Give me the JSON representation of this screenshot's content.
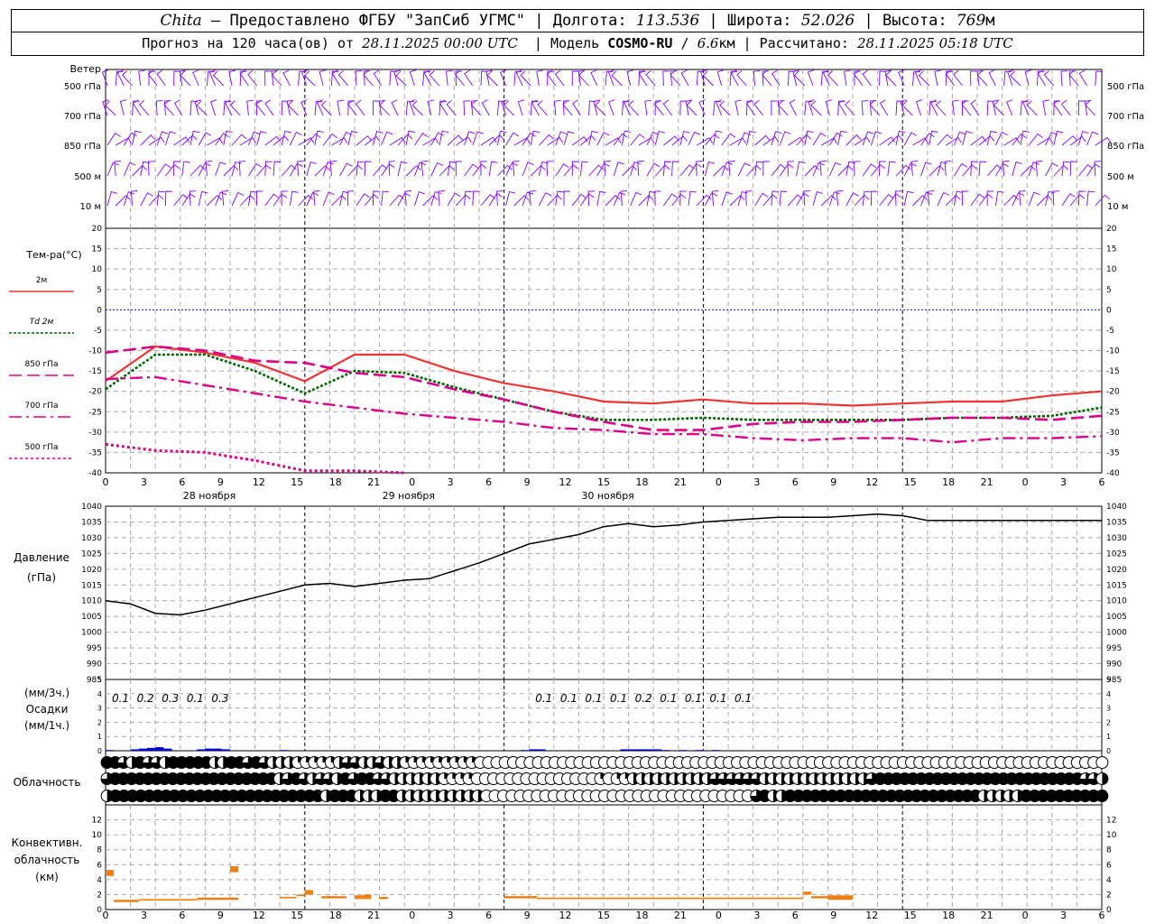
{
  "header": {
    "station": "Chita",
    "provider": " — Предоставлено ФГБУ \"ЗапСиб УГМС\" | Долгота: ",
    "lon": "113.536",
    "lat_label": " | Широта: ",
    "lat": "52.026",
    "alt_label": " | Высота: ",
    "alt": "769",
    "alt_unit": "м",
    "forecast_label": "Прогноз на 120 часа(ов) от ",
    "forecast_start": "28.11.2025 00:00 UTC",
    "model_label": "  | Модель ",
    "model": "COSMO-RU",
    "model_sep": " / ",
    "resolution": "6.6",
    "res_unit": "км",
    "calc_label": " | Рассчитано: ",
    "calc_time": "28.11.2025 05:18 UTC"
  },
  "labels": {
    "wind": "Ветер",
    "wind_levels": [
      "500 гПа",
      "700 гПа",
      "850 гПа",
      "500 м",
      "10  м"
    ],
    "temp_title": "Тем-ра(°C)",
    "legend_2m": "2м",
    "legend_td": "Td",
    "legend_td_suffix": "2м",
    "legend_850": "850 гПа",
    "legend_700": "700 гПа",
    "legend_500": "500 гПа",
    "pressure_title": "Давление",
    "pressure_unit": "(гПа)",
    "precip_unit3": "(мм/3ч.)",
    "precip_title": "Осадки",
    "precip_unit1": "(мм/1ч.)",
    "cloud_title": "Облачность",
    "conv_title1": "Конвективн.",
    "conv_title2": "облачность",
    "conv_unit": "(км)"
  },
  "colors": {
    "t2m": "#ee3333",
    "td2m": "#006600",
    "t850": "#dd0088",
    "t700": "#dd0088",
    "t500": "#dd0088",
    "wind": "#7f00ff",
    "pressure": "#000000",
    "precip": "#0000cc",
    "conv": "#ee7f11",
    "zero_line": "#0000ff"
  },
  "chart_data": [
    {
      "type": "line",
      "name": "temperature",
      "x_ticks": [
        "0",
        "3",
        "6",
        "9",
        "12",
        "15",
        "18",
        "21",
        "0",
        "3",
        "6",
        "9",
        "12",
        "15",
        "18",
        "21",
        "0",
        "3",
        "6",
        "9",
        "12",
        "15",
        "18",
        "21",
        "0",
        "3",
        "6"
      ],
      "day_labels": [
        "28 ноября",
        "29 ноября",
        "30 ноября"
      ],
      "ylim": [
        -40,
        20
      ],
      "y_ticks": [
        20,
        15,
        10,
        5,
        0,
        -5,
        -10,
        -15,
        -20,
        -25,
        -30,
        -35,
        -40
      ],
      "x_hours": [
        0,
        6,
        12,
        18,
        24,
        30,
        36,
        42,
        48,
        54,
        60,
        66,
        72,
        78,
        84,
        90,
        96,
        102,
        108,
        114,
        120
      ],
      "series": [
        {
          "name": "2м",
          "key": "t2m",
          "values": [
            -17.5,
            -9,
            -10.5,
            -13,
            -17.5,
            -11,
            -11,
            -15,
            -18,
            -20,
            -22.5,
            -23,
            -22,
            -23,
            -23,
            -23.5,
            -23,
            -22.5,
            -22.5,
            -21,
            -20
          ]
        },
        {
          "name": "Td 2м",
          "key": "td2m",
          "values": [
            -19.5,
            -11,
            -11,
            -15,
            -20.5,
            -15,
            -15.5,
            -19,
            -22,
            -25,
            -27,
            -27,
            -26.5,
            -27,
            -27,
            -27,
            -27,
            -26.5,
            -26.5,
            -26,
            -24
          ]
        },
        {
          "name": "850 гПа",
          "key": "t850",
          "values": [
            -10.5,
            -9,
            -10,
            -12.5,
            -13,
            -15.5,
            -16.5,
            -19.5,
            -22,
            -25,
            -27.5,
            -29.5,
            -29.5,
            -28,
            -27.5,
            -27.5,
            -27,
            -26.5,
            -26.5,
            -27,
            -26
          ]
        },
        {
          "name": "700 гПа",
          "key": "t700",
          "values": [
            -17,
            -16.5,
            -18.5,
            -20.5,
            -22.5,
            -24,
            -25.5,
            -26.5,
            -27.5,
            -29,
            -29.5,
            -30.5,
            -30.5,
            -31.5,
            -32,
            -31.5,
            -31.5,
            -32.5,
            -31.5,
            -31.5,
            -31
          ]
        },
        {
          "name": "500 гПа",
          "key": "t500",
          "values": [
            -33,
            -34.5,
            -35,
            -37,
            -39.5,
            -39.5,
            -41,
            null,
            null,
            null,
            null,
            null,
            null,
            null,
            null,
            null,
            null,
            null,
            null,
            null,
            null
          ]
        }
      ]
    },
    {
      "type": "line",
      "name": "pressure",
      "ylim": [
        985,
        1040
      ],
      "y_ticks": [
        1040,
        1035,
        1030,
        1025,
        1020,
        1015,
        1010,
        1005,
        1000,
        995,
        990,
        985
      ],
      "x_hours": [
        0,
        3,
        6,
        9,
        12,
        15,
        18,
        21,
        24,
        27,
        30,
        33,
        36,
        39,
        42,
        45,
        48,
        51,
        54,
        57,
        60,
        63,
        66,
        69,
        72,
        75,
        78,
        81,
        84,
        87,
        90,
        93,
        96,
        99,
        102,
        105,
        108,
        111,
        114,
        117,
        120
      ],
      "values": [
        1010,
        1009,
        1006,
        1005.5,
        1007,
        1009,
        1011,
        1013,
        1015,
        1015.5,
        1014.5,
        1015.5,
        1016.5,
        1017,
        1019.5,
        1022,
        1025,
        1028,
        1029.5,
        1031,
        1033.5,
        1034.5,
        1033.5,
        1034,
        1035,
        1035.5,
        1036,
        1036.5,
        1036.5,
        1036.5,
        1037,
        1037.5,
        1037,
        1035.5,
        1035.5,
        1035.5,
        1035.5,
        1035.5,
        1035.5,
        1035.5,
        1035.5
      ]
    },
    {
      "type": "bar",
      "name": "precipitation",
      "ylim": [
        0,
        5
      ],
      "y_ticks": [
        5,
        4,
        3,
        2,
        1,
        0
      ],
      "labels_3h": [
        {
          "hour": 1.5,
          "text": "0.1"
        },
        {
          "hour": 4.5,
          "text": "0.2"
        },
        {
          "hour": 7.5,
          "text": "0.3"
        },
        {
          "hour": 10.5,
          "text": "0.1"
        },
        {
          "hour": 13.5,
          "text": "0.3"
        },
        {
          "hour": 52.5,
          "text": "0.1"
        },
        {
          "hour": 55.5,
          "text": "0.1"
        },
        {
          "hour": 58.5,
          "text": "0.1"
        },
        {
          "hour": 61.5,
          "text": "0.1"
        },
        {
          "hour": 64.5,
          "text": "0.2"
        },
        {
          "hour": 67.5,
          "text": "0.1"
        },
        {
          "hour": 70.5,
          "text": "0.1"
        },
        {
          "hour": 73.5,
          "text": "0.1"
        },
        {
          "hour": 76.5,
          "text": "0.1"
        }
      ],
      "hourly": [
        {
          "hour": 1,
          "value": 0.05
        },
        {
          "hour": 4,
          "value": 0.1
        },
        {
          "hour": 5,
          "value": 0.15
        },
        {
          "hour": 6,
          "value": 0.2
        },
        {
          "hour": 7,
          "value": 0.25
        },
        {
          "hour": 8,
          "value": 0.15
        },
        {
          "hour": 12,
          "value": 0.1
        },
        {
          "hour": 13,
          "value": 0.15
        },
        {
          "hour": 14,
          "value": 0.15
        },
        {
          "hour": 15,
          "value": 0.1
        },
        {
          "hour": 22,
          "value": 0.05
        },
        {
          "hour": 51,
          "value": 0.05
        },
        {
          "hour": 52,
          "value": 0.1
        },
        {
          "hour": 53,
          "value": 0.1
        },
        {
          "hour": 63,
          "value": 0.1
        },
        {
          "hour": 64,
          "value": 0.1
        },
        {
          "hour": 65,
          "value": 0.1
        },
        {
          "hour": 66,
          "value": 0.1
        },
        {
          "hour": 67,
          "value": 0.1
        },
        {
          "hour": 68,
          "value": 0.05
        },
        {
          "hour": 70,
          "value": 0.05
        },
        {
          "hour": 72,
          "value": 0.05
        },
        {
          "hour": 74,
          "value": 0.05
        }
      ]
    },
    {
      "type": "table",
      "name": "cloudiness",
      "rows_fraction_per_hour": [
        "1 1 .75 .5 1 .75 .75 .5 1 1 1 1 1 .5 .5 1 1 .75 1 .75 .5 .5 .5 .25 .25 .25 .25 .25 .5 .75 .75 .5 .5 .75 .5 .5 .25 .25 .25 .25 .25 .25 .25 .25 .25 0 0 0 0 0 0 0 0 0 0 0 0 0 0 0 0 0 0 0 0 0 0 0 0 0 0 0 0 0 0 0 0 0 0 0 0 0 0 0 0 0 0 0 0 0 0 0 0 0 0 0 0 0 0 0 0 0 0 0 0 0 0 0 0 0 0 0 0 0 0 0 0 0 0 0 0",
        ".75 1 1 1 1 1 1 1 1 1 1 1 1 1 1 1 1 1 1 1 1 .5 .75 1 .75 .5 .75 .75 .5 1 .75 1 1 .75 .75 .5 .5 .5 .5 .5 .5 .25 .25 .25 .25 0 0 0 0 0 0 0 0 0 0 0 0 0 0 0 .25 0 .25 .25 .5 .5 .5 .5 .5 .5 .5 .5 .5 .5 .75 .75 .75 .75 .75 .75 .5 .5 .5 .5 .5 .5 .5 .5 .5 .5 .5 .5 .5 .75 1 1 1 1 1 1 1 1 1 1 1 1 1 1 1 1 1 1 1 1 1 1 1 1 1 .75 .75 .5",
        ".5 1 1 1 1 1 1 1 1 1 1 1 1 1 1 1 1 1 1 1 1 1 1 1 1 1 .5 1 1 1 .5 .5 .5 1 1 .5 .5 .5 .5 .5 .5 .5 .5 .5 .5 0 0 0 0 0 0 0 0 0 0 0 0 0 0 0 0 0 0 0 0 0 0 0 0 0 0 0 0 0 0 0 0 .75 1 .5 .5 1 1 1 1 1 1 1 1 1 1 1 1 1 1 1 1 1 1 1 1 1 1 1 .5 .5 .5 .5 .5 1 1 1 1 1 1 1 1 1 1"
      ]
    },
    {
      "type": "bar",
      "name": "convective_cloud",
      "ylim": [
        0,
        14
      ],
      "y_ticks": [
        12,
        10,
        8,
        6,
        4,
        2,
        0
      ],
      "segments": [
        {
          "from": 1,
          "to": 4,
          "base": 1.0,
          "top": 1.3
        },
        {
          "from": 4,
          "to": 11,
          "base": 1.2,
          "top": 1.4
        },
        {
          "from": 11,
          "to": 16,
          "base": 1.3,
          "top": 1.6
        },
        {
          "from": 21,
          "to": 23,
          "base": 1.5,
          "top": 1.7
        },
        {
          "from": 23,
          "to": 24,
          "base": 1.8,
          "top": 2.0
        },
        {
          "from": 26,
          "to": 29,
          "base": 1.5,
          "top": 1.8
        },
        {
          "from": 33,
          "to": 34,
          "base": 1.4,
          "top": 1.7
        },
        {
          "from": 48,
          "to": 52,
          "base": 1.5,
          "top": 1.8
        },
        {
          "from": 52,
          "to": 72,
          "base": 1.4,
          "top": 1.6
        },
        {
          "from": 72,
          "to": 84,
          "base": 1.4,
          "top": 1.6
        },
        {
          "from": 84,
          "to": 85,
          "base": 2.0,
          "top": 2.2
        },
        {
          "from": 85,
          "to": 87,
          "base": 1.5,
          "top": 1.8
        },
        {
          "from": 87,
          "to": 90,
          "base": 1.3,
          "top": 1.9
        }
      ],
      "tops": [
        {
          "hour": 1,
          "base": 4.5,
          "top": 5.3
        },
        {
          "hour": 16,
          "base": 5.0,
          "top": 5.8
        },
        {
          "hour": 25,
          "base": 2.0,
          "top": 2.6
        },
        {
          "hour": 31,
          "base": 1.4,
          "top": 1.9
        },
        {
          "hour": 32,
          "base": 1.4,
          "top": 2.0
        },
        {
          "hour": 85,
          "base": 2.0,
          "top": 2.4
        }
      ]
    }
  ]
}
